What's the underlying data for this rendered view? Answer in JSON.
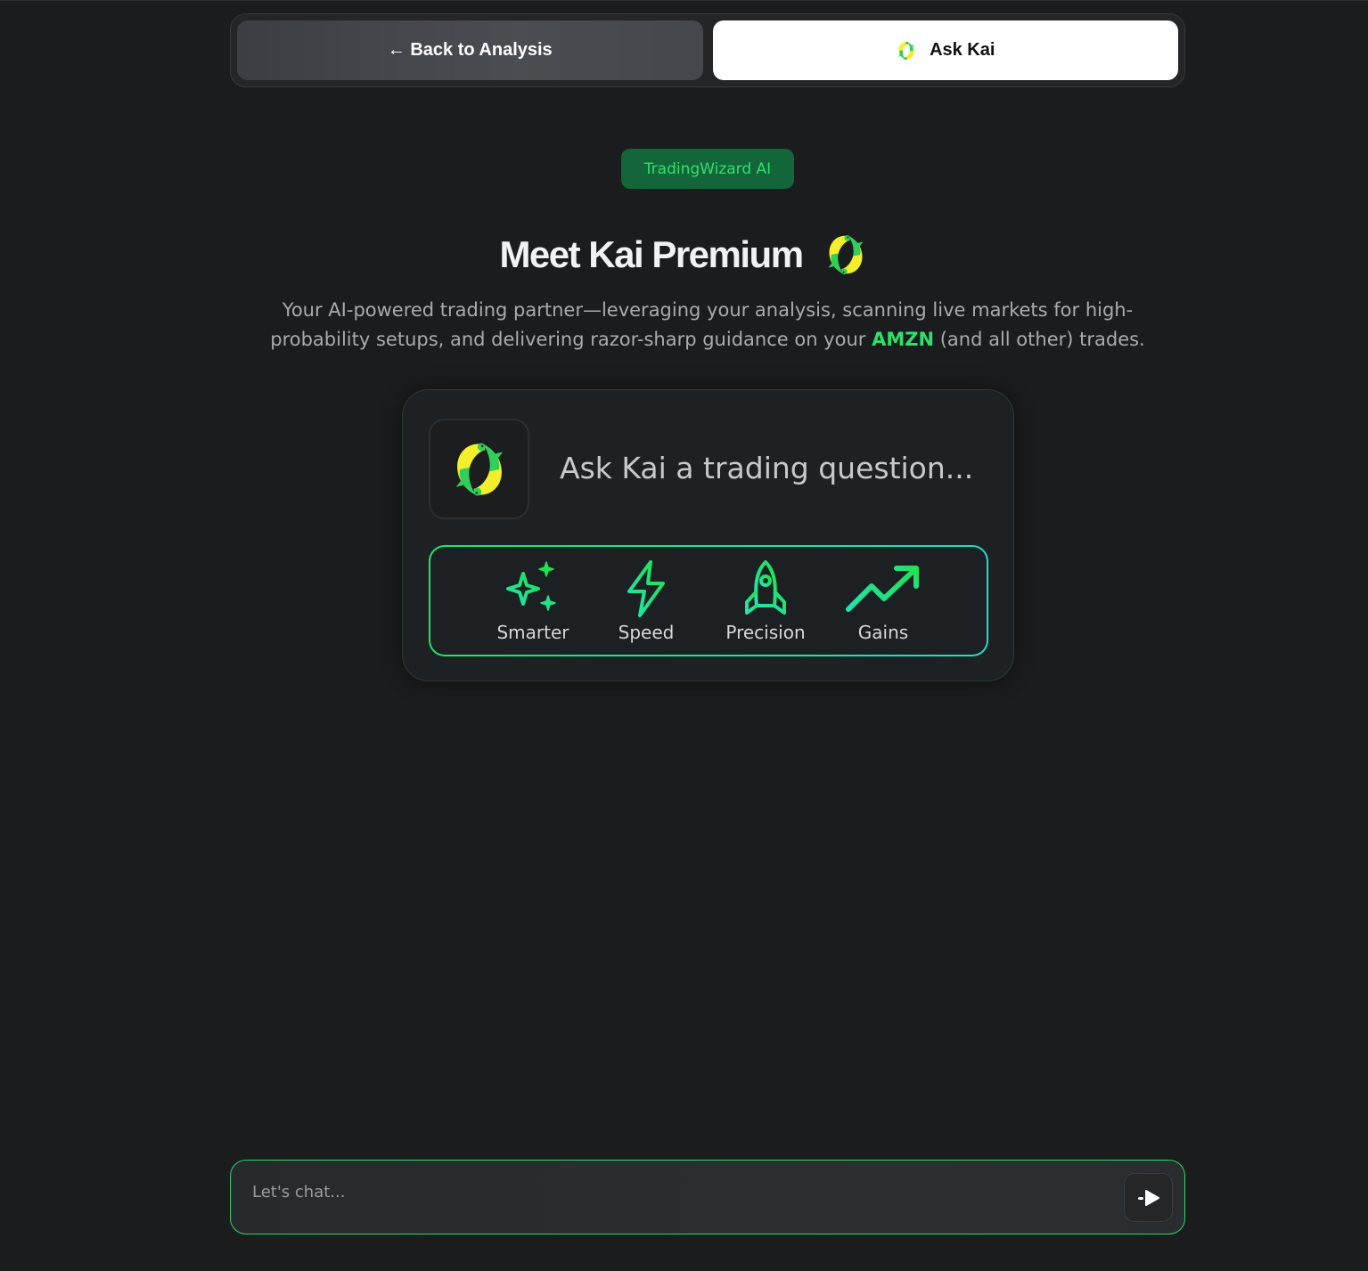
{
  "tabs": {
    "back_label": "← Back to Analysis",
    "kai_label": "Ask Kai"
  },
  "badge": "TradingWizard AI",
  "headline": "Meet Kai Premium",
  "subtitle": {
    "before": "Your AI-powered trading partner—leveraging your analysis, scanning live markets for high-probability setups, and delivering razor-sharp guidance on your ",
    "ticker": "AMZN",
    "after": " (and all other) trades."
  },
  "card": {
    "question": "Ask Kai a trading question...",
    "features": [
      {
        "label": "Smarter",
        "icon": "sparkles-icon"
      },
      {
        "label": "Speed",
        "icon": "lightning-icon"
      },
      {
        "label": "Precision",
        "icon": "rocket-icon"
      },
      {
        "label": "Gains",
        "icon": "trending-up-icon"
      }
    ]
  },
  "chat": {
    "placeholder": "Let's chat...",
    "value": ""
  },
  "colors": {
    "accent_green": "#2fe06b",
    "badge_bg": "#13653a",
    "background": "#1b1c1e",
    "logo_yellow": "#f4ef2b"
  }
}
